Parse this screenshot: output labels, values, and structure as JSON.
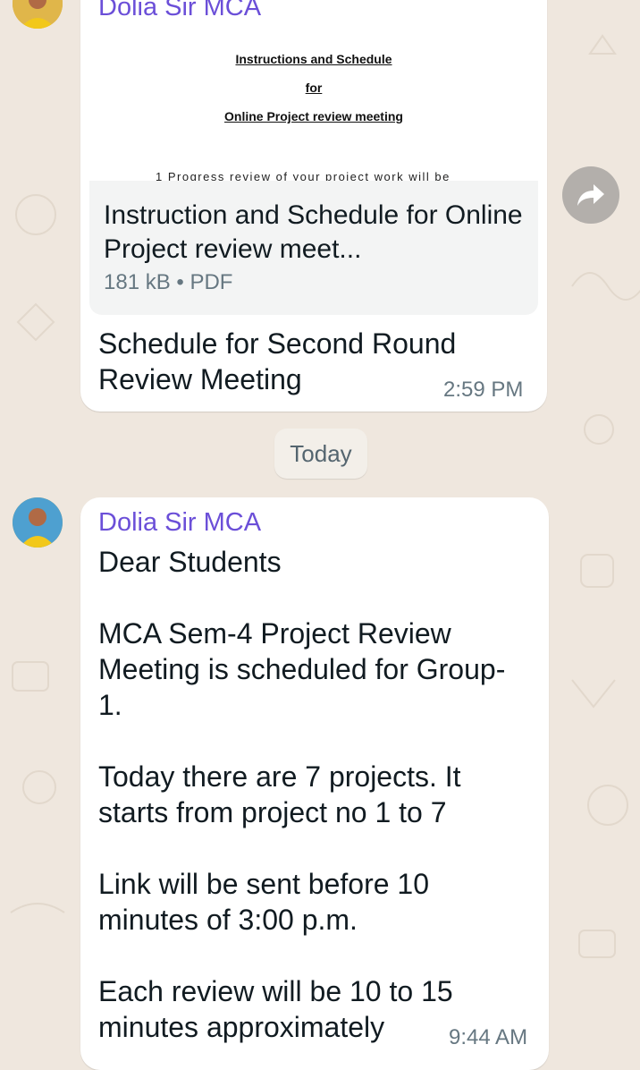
{
  "colors": {
    "wallpaper": "#efe7de",
    "bubble": "#ffffff",
    "sender_name": "#6b4fd8",
    "timestamp": "#667781",
    "text": "#111b21"
  },
  "messages": [
    {
      "sender": "Dolia Sir MCA",
      "attachment": {
        "icon": "pdf-document",
        "preview_lines": [
          "Instructions and Schedule",
          "for",
          "Online Project review meeting"
        ],
        "preview_cut_text": "1 Progress review of your project work will be",
        "file_name": "Instruction and Schedule for Online Project review meet...",
        "size": "181 kB",
        "separator": "•",
        "type": "PDF"
      },
      "caption": "Schedule for Second Round Review Meeting",
      "time": "2:59 PM"
    },
    {
      "sender": "Dolia Sir MCA",
      "text": "Dear Students\n\nMCA Sem-4 Project Review Meeting is scheduled for Group-1.\n\nToday there are 7 projects. It starts from project no 1 to 7\n\nLink will be sent before 10 minutes of 3:00 p.m.\n\nEach review will be 10 to 15 minutes approximately",
      "time": "9:44 AM"
    }
  ],
  "date_separator": "Today",
  "icons": {
    "avatar": "profile-photo",
    "forward": "forward-arrow-icon"
  }
}
